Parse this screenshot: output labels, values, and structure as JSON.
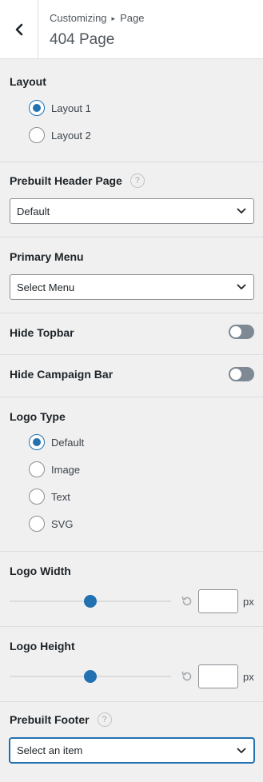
{
  "header": {
    "breadcrumb_parent": "Customizing",
    "breadcrumb_separator": "▸",
    "breadcrumb_child": "Page",
    "title": "404 Page"
  },
  "layout": {
    "title": "Layout",
    "options": [
      {
        "label": "Layout 1",
        "checked": true
      },
      {
        "label": "Layout 2",
        "checked": false
      }
    ]
  },
  "prebuilt_header_page": {
    "title": "Prebuilt Header Page",
    "help": "?",
    "selected": "Default"
  },
  "primary_menu": {
    "title": "Primary Menu",
    "selected": "Select Menu"
  },
  "hide_topbar": {
    "title": "Hide Topbar",
    "enabled": false
  },
  "hide_campaign_bar": {
    "title": "Hide Campaign Bar",
    "enabled": false
  },
  "logo_type": {
    "title": "Logo Type",
    "options": [
      {
        "label": "Default",
        "checked": true
      },
      {
        "label": "Image",
        "checked": false
      },
      {
        "label": "Text",
        "checked": false
      },
      {
        "label": "SVG",
        "checked": false
      }
    ]
  },
  "logo_width": {
    "title": "Logo Width",
    "value": "",
    "unit": "px",
    "slider_fraction": 0.5
  },
  "logo_height": {
    "title": "Logo Height",
    "value": "",
    "unit": "px",
    "slider_fraction": 0.5
  },
  "prebuilt_footer": {
    "title": "Prebuilt Footer",
    "help": "?",
    "selected": "Select an item"
  },
  "colors": {
    "accent": "#2271b1",
    "toggle_off": "#7e8993",
    "panel_bg": "#f0f0f1"
  },
  "icons": {
    "back": "chevron-left-icon",
    "dropdown": "chevron-down-icon",
    "reset": "reset-icon",
    "help": "help-icon"
  }
}
